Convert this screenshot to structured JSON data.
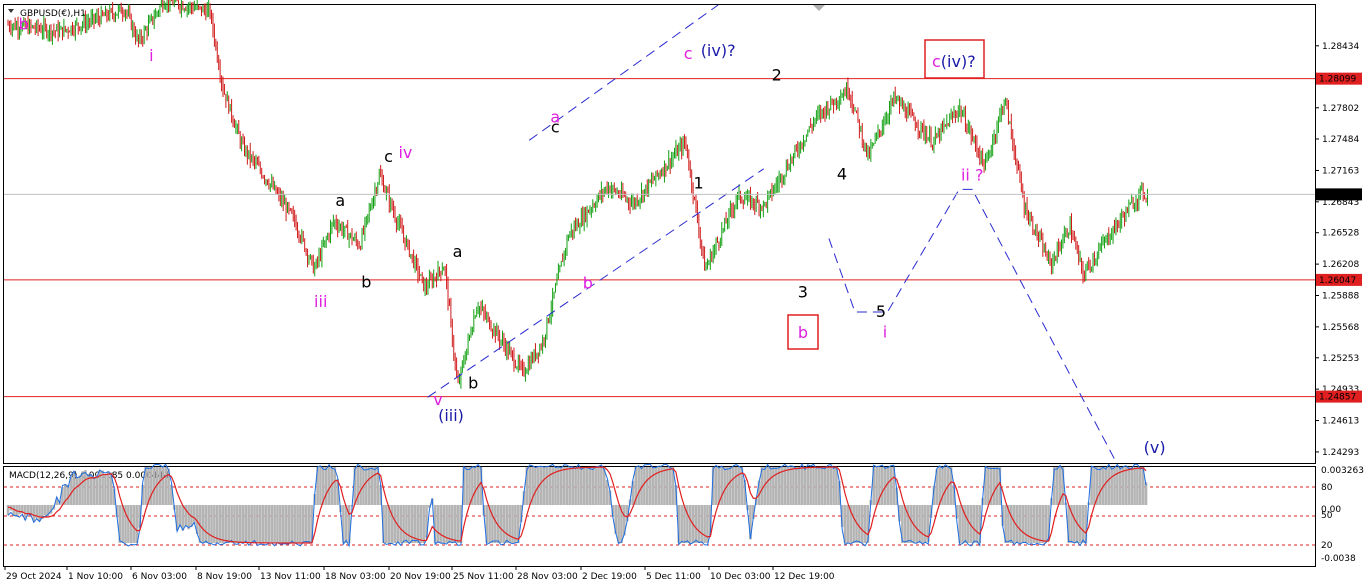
{
  "chart_data": [
    {
      "type": "candlestick",
      "symbol_label": "GBPUSD(€),H1",
      "y_ticks": [
        "1.28434",
        "1.28099",
        "1.27802",
        "1.27484",
        "1.27163",
        "1.26843",
        "1.26528",
        "1.26208",
        "1.25888",
        "1.25568",
        "1.25253",
        "1.24933",
        "1.24613",
        "1.24293"
      ],
      "ylim": [
        1.2418,
        1.2885
      ],
      "current_price": "1.26919",
      "levels": [
        {
          "label": "1.28099",
          "value": 1.28099,
          "color": "#e02020"
        },
        {
          "label": "1.26047",
          "value": 1.26047,
          "color": "#e02020"
        },
        {
          "label": "1.24857",
          "value": 1.24857,
          "color": "#e02020"
        }
      ],
      "x_ticks": [
        "29 Oct 2024",
        "1 Nov 10:00",
        "6 Nov 03:00",
        "8 Nov 19:00",
        "13 Nov 11:00",
        "18 Nov 03:00",
        "20 Nov 19:00",
        "25 Nov 11:00",
        "28 Nov 03:00",
        "2 Dec 19:00",
        "5 Dec 11:00",
        "10 Dec 03:00",
        "12 Dec 19:00"
      ],
      "price_path": [
        [
          0.0,
          1.2865
        ],
        [
          0.04,
          1.2858
        ],
        [
          0.09,
          1.2881
        ],
        [
          0.1,
          1.2847
        ],
        [
          0.12,
          1.289
        ],
        [
          0.155,
          1.2878
        ],
        [
          0.165,
          1.28
        ],
        [
          0.18,
          1.274
        ],
        [
          0.2,
          1.2705
        ],
        [
          0.22,
          1.2665
        ],
        [
          0.235,
          1.2615
        ],
        [
          0.25,
          1.2665
        ],
        [
          0.27,
          1.264
        ],
        [
          0.285,
          1.2712
        ],
        [
          0.3,
          1.266
        ],
        [
          0.32,
          1.2596
        ],
        [
          0.335,
          1.262
        ],
        [
          0.345,
          1.2495
        ],
        [
          0.36,
          1.258
        ],
        [
          0.38,
          1.254
        ],
        [
          0.395,
          1.251
        ],
        [
          0.41,
          1.254
        ],
        [
          0.43,
          1.265
        ],
        [
          0.46,
          1.27
        ],
        [
          0.48,
          1.2683
        ],
        [
          0.52,
          1.2745
        ],
        [
          0.535,
          1.2615
        ],
        [
          0.56,
          1.269
        ],
        [
          0.58,
          1.268
        ],
        [
          0.62,
          1.277
        ],
        [
          0.645,
          1.28
        ],
        [
          0.66,
          1.273
        ],
        [
          0.68,
          1.279
        ],
        [
          0.71,
          1.2745
        ],
        [
          0.73,
          1.278
        ],
        [
          0.75,
          1.272
        ],
        [
          0.765,
          1.279
        ],
        [
          0.78,
          1.268
        ],
        [
          0.8,
          1.262
        ],
        [
          0.815,
          1.266
        ],
        [
          0.825,
          1.261
        ],
        [
          0.845,
          1.265
        ],
        [
          0.87,
          1.2695
        ],
        [
          0.875,
          1.269
        ]
      ],
      "elliott_labels": [
        {
          "text": "b",
          "color": "#e020e0",
          "at": [
            0.012,
            1.286
          ]
        },
        {
          "text": "i",
          "color": "#e020e0",
          "at": [
            0.11,
            1.2828
          ]
        },
        {
          "text": "iii",
          "color": "#e020e0",
          "at": [
            0.24,
            1.2577
          ]
        },
        {
          "text": "a",
          "color": "#000000",
          "at": [
            0.255,
            1.268
          ]
        },
        {
          "text": "b",
          "color": "#000000",
          "at": [
            0.275,
            1.2597
          ]
        },
        {
          "text": "c",
          "color": "#000000",
          "at": [
            0.292,
            1.2725
          ]
        },
        {
          "text": "iv",
          "color": "#e020e0",
          "at": [
            0.305,
            1.2729
          ]
        },
        {
          "text": "a",
          "color": "#000000",
          "at": [
            0.345,
            1.2628
          ]
        },
        {
          "text": "v",
          "color": "#e020e0",
          "at": [
            0.33,
            1.2477
          ]
        },
        {
          "text": "(iii)",
          "color": "#1a1aa8",
          "at": [
            0.34,
            1.2461
          ]
        },
        {
          "text": "b",
          "color": "#000000",
          "at": [
            0.357,
            1.2494
          ]
        },
        {
          "text": "a",
          "color": "#e020e0",
          "at": [
            0.42,
            1.2765
          ]
        },
        {
          "text": "c",
          "color": "#000000",
          "at": [
            0.42,
            1.2755
          ]
        },
        {
          "text": "b",
          "color": "#e020e0",
          "at": [
            0.445,
            1.2596
          ]
        },
        {
          "text": "c",
          "color": "#e020e0",
          "at": [
            0.522,
            1.283
          ]
        },
        {
          "text": "(iv)?",
          "color": "#1a1aa8",
          "at": [
            0.545,
            1.2833
          ]
        },
        {
          "text": "1",
          "color": "#000000",
          "at": [
            0.53,
            1.2698
          ]
        },
        {
          "text": "2",
          "color": "#000000",
          "at": [
            0.59,
            1.2808
          ]
        },
        {
          "text": "4",
          "color": "#000000",
          "at": [
            0.64,
            1.2707
          ]
        },
        {
          "text": "3",
          "color": "#000000",
          "at": [
            0.61,
            1.2587
          ]
        },
        {
          "text": "5",
          "color": "#000000",
          "at": [
            0.67,
            1.2567
          ]
        },
        {
          "text": "i",
          "color": "#e020e0",
          "at": [
            0.673,
            1.2546
          ]
        },
        {
          "text": "ii ?",
          "color": "#e020e0",
          "at": [
            0.74,
            1.2706
          ]
        },
        {
          "text": "(v)",
          "color": "#1a1aa8",
          "at": [
            0.88,
            1.2428
          ]
        }
      ],
      "boxed_labels": [
        {
          "prefix": "c",
          "main": "(iv)?",
          "prefix_color": "#e020e0",
          "main_color": "#1a1aa8",
          "border": "#e02020"
        },
        {
          "prefix": "",
          "main": "b",
          "prefix_color": "#e020e0",
          "main_color": "#e020e0",
          "border": "#e02020"
        }
      ],
      "channel_color": "#2a2ad0",
      "projection_color": "#2a2ad0"
    },
    {
      "type": "oscillator",
      "label": "MACD(12,26,9) 0.001185 0.000444",
      "right_ticks": [
        "0.003263",
        "80",
        "0.00",
        "50",
        "20",
        "-0.0038"
      ],
      "levels_dashed": [
        80,
        50,
        20
      ],
      "histogram_color": "#b4b4b4",
      "main_line_color": "#1e6ee0",
      "signal_line_color": "#e02020"
    }
  ]
}
